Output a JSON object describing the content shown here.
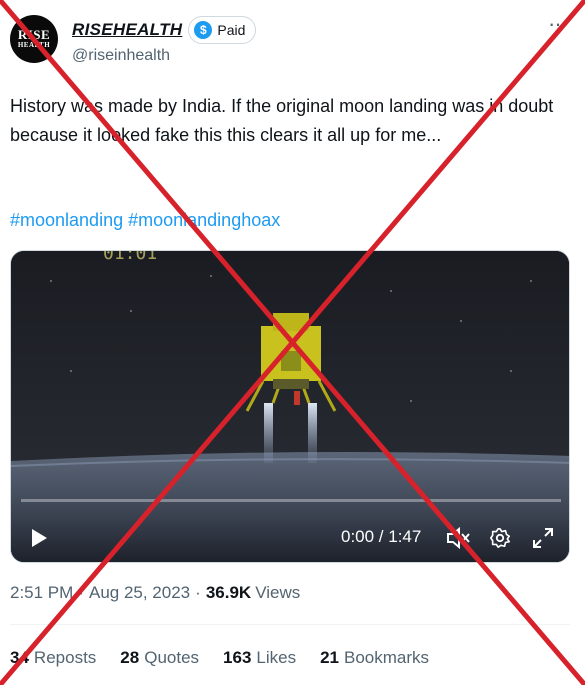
{
  "author": {
    "avatar_text_line1": "RISE",
    "avatar_text_line2": "HEALTH",
    "display_name": "RISEHEALTH",
    "badge_label": "Paid",
    "handle": "@riseinhealth"
  },
  "tweet": {
    "text": "History was made by India. If the original moon landing was in doubt because it looked fake this this clears it all up for me...",
    "hashtags": [
      "#moonlanding",
      "#moonlandinghoax"
    ]
  },
  "video": {
    "time_display": "0:00 / 1:47",
    "progress": 0
  },
  "meta": {
    "time": "2:51 PM",
    "date": "Aug 25, 2023",
    "views_count": "36.9K",
    "views_label": "Views"
  },
  "stats": [
    {
      "count": "34",
      "label": "Reposts"
    },
    {
      "count": "28",
      "label": "Quotes"
    },
    {
      "count": "163",
      "label": "Likes"
    },
    {
      "count": "21",
      "label": "Bookmarks"
    }
  ],
  "colors": {
    "link": "#1d9bf0",
    "cross": "#d7222b",
    "text_secondary": "#536471"
  },
  "icons": [
    "dollar-coin-icon",
    "more-icon",
    "play-icon",
    "mute-icon",
    "settings-icon",
    "fullscreen-icon"
  ]
}
